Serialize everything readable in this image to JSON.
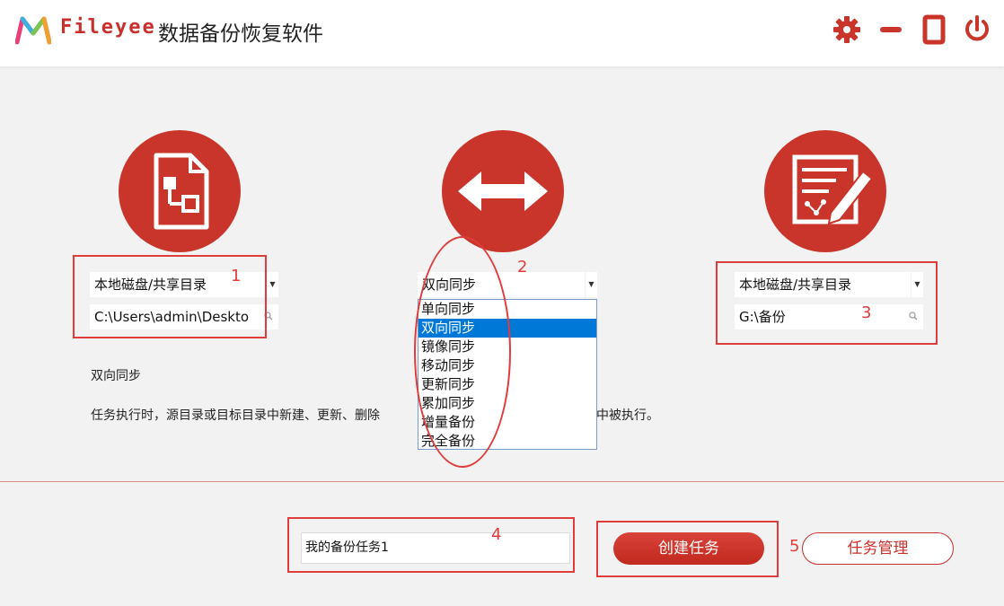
{
  "header": {
    "brand": "Fileyee",
    "title": "数据备份恢复软件"
  },
  "source": {
    "type_value": "本地磁盘/共享目录",
    "path_value": "C:\\Users\\admin\\Deskto"
  },
  "mode": {
    "selected": "双向同步",
    "options": [
      "单向同步",
      "双向同步",
      "镜像同步",
      "移动同步",
      "更新同步",
      "累加同步",
      "增量备份",
      "完全备份"
    ]
  },
  "target": {
    "type_value": "本地磁盘/共享目录",
    "path_value": "G:\\备份"
  },
  "description": {
    "title": "双向同步",
    "text_left": "任务执行时，源目录或目标目录中新建、更新、删除",
    "text_right": "中被执行。"
  },
  "task": {
    "name_value": "我的备份任务1",
    "create_label": "创建任务",
    "manage_label": "任务管理"
  },
  "annotations": [
    "1",
    "2",
    "3",
    "4",
    "5"
  ],
  "colors": {
    "brand_red": "#c9352b",
    "annotation_red": "#e03c3c",
    "selection_blue": "#0078d7"
  },
  "icons": [
    "logo-icon",
    "gear-icon",
    "minimize-icon",
    "maximize-icon",
    "power-icon",
    "document-flow-icon",
    "double-arrow-icon",
    "edit-note-icon",
    "search-icon"
  ]
}
